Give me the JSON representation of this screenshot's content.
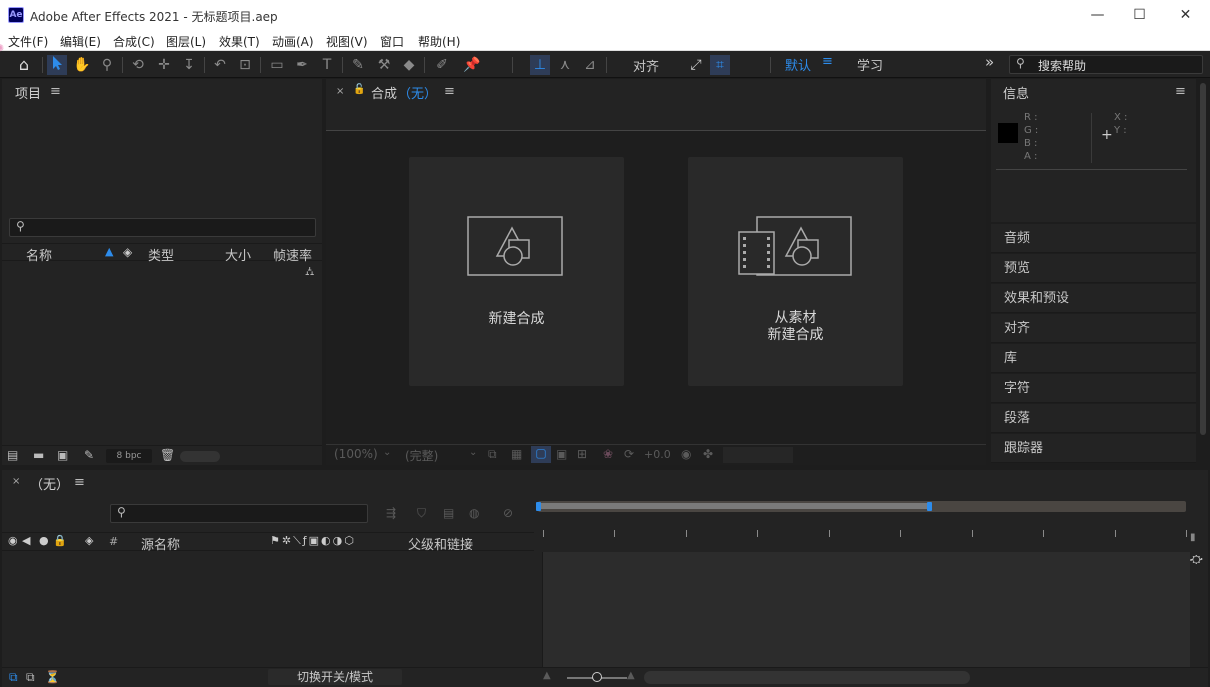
{
  "window": {
    "app_badge": "Ae",
    "title": "Adobe After Effects 2021 - 无标题项目.aep",
    "minimize": "—",
    "maximize": "☐",
    "close": "✕"
  },
  "menu": [
    "文件(F)",
    "编辑(E)",
    "合成(C)",
    "图层(L)",
    "效果(T)",
    "动画(A)",
    "视图(V)",
    "窗口",
    "帮助(H)"
  ],
  "toolbar": {
    "snap_label": "对齐",
    "workspace_default": "默认",
    "workspace_learn": "学习",
    "overflow": "»",
    "search_placeholder": "搜索帮助"
  },
  "project_panel": {
    "title": "项目",
    "columns": [
      "名称",
      "类型",
      "大小",
      "帧速率"
    ],
    "bpc": "8 bpc"
  },
  "comp_panel": {
    "title": "合成",
    "comp_name": "（无）",
    "tile_new": "新建合成",
    "tile_footage_line1": "从素材",
    "tile_footage_line2": "新建合成",
    "zoom": "(100%)",
    "resolution": "(完整)",
    "exposure": "+0.0"
  },
  "info_panel": {
    "title": "信息",
    "channels": [
      "R :",
      "G :",
      "B :",
      "A :"
    ],
    "coords": [
      "X :",
      "Y :"
    ],
    "swatch_color": "#000000"
  },
  "right_panels": [
    "音频",
    "预览",
    "效果和预设",
    "对齐",
    "库",
    "字符",
    "段落",
    "跟踪器"
  ],
  "timeline": {
    "tab": "（无）",
    "col_source": "源名称",
    "col_parent": "父级和链接",
    "col_hash": "#",
    "toggle_modes": "切换开关/模式",
    "accent": "#2d8ceb"
  }
}
